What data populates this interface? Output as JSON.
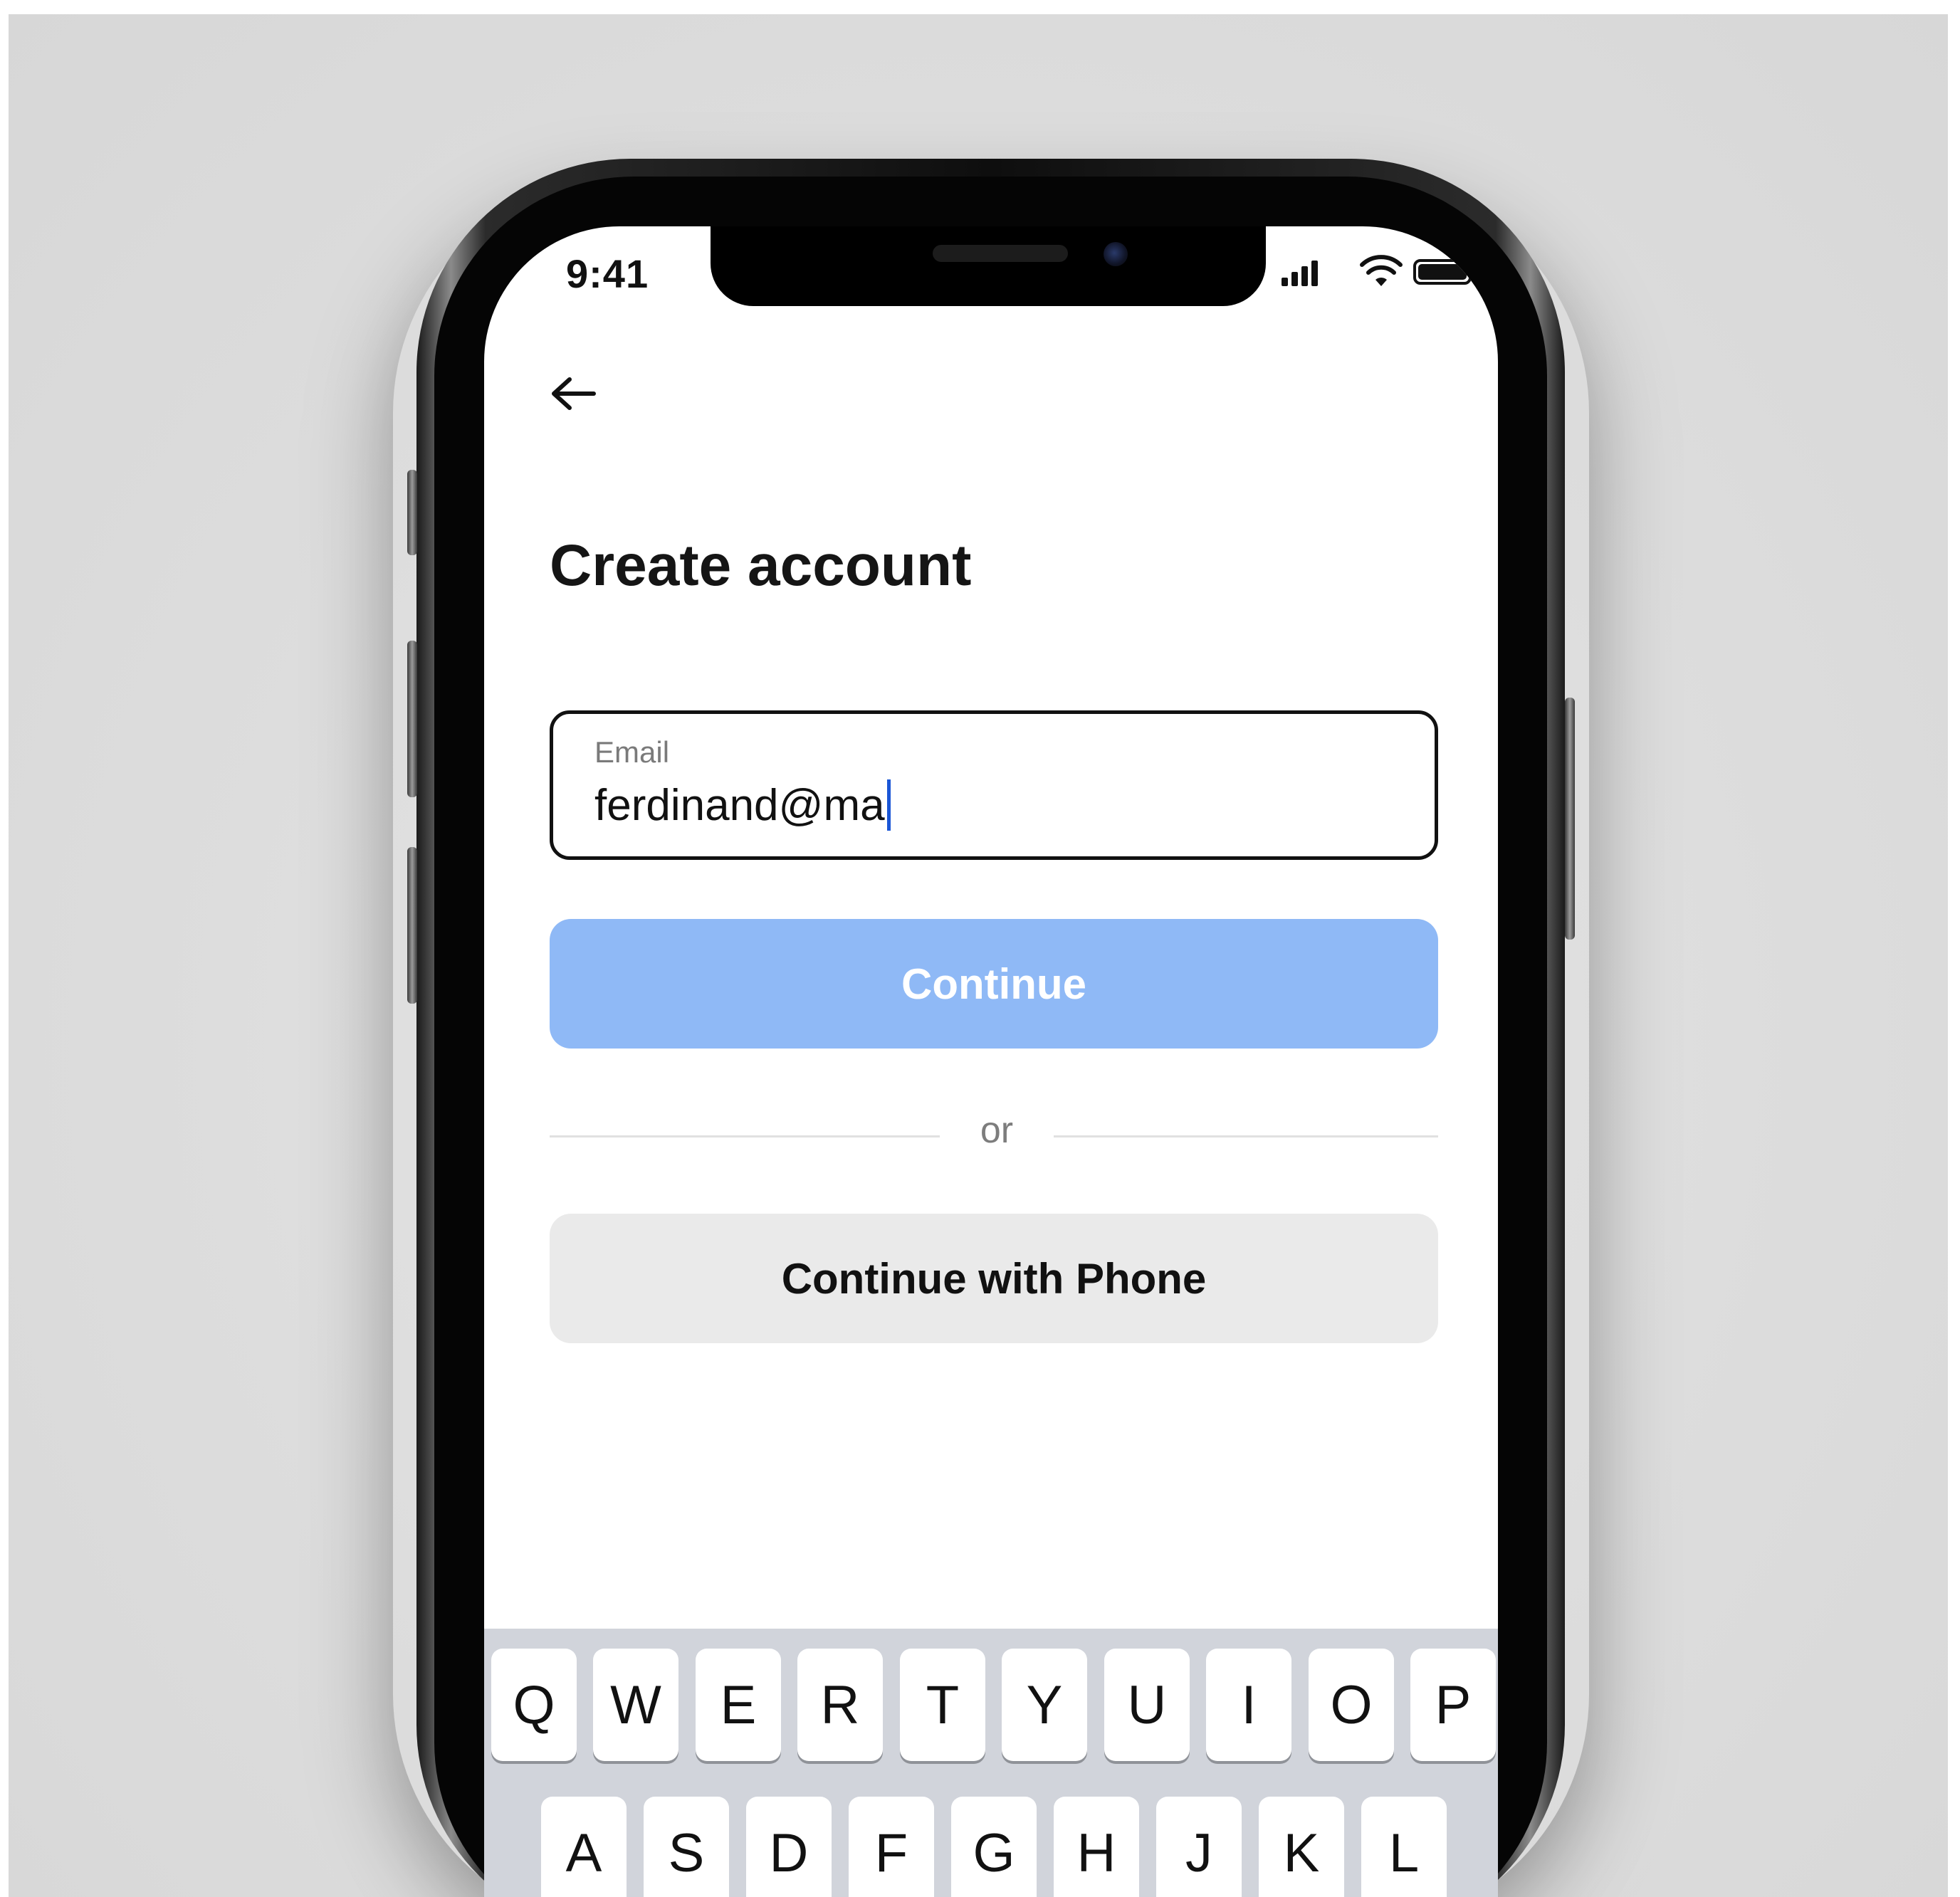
{
  "status_bar": {
    "time": "9:41",
    "icons": [
      "cellular-signal-icon",
      "wifi-icon",
      "battery-icon"
    ]
  },
  "navigation": {
    "back_icon": "arrow-left-icon"
  },
  "header": {
    "title": "Create account"
  },
  "form": {
    "email": {
      "label": "Email",
      "value": "ferdinand@ma"
    },
    "continue_label": "Continue",
    "divider_text": "or",
    "phone_label": "Continue with Phone"
  },
  "colors": {
    "primary_disabled": "#8fb9f6",
    "secondary_button": "#eaeaea",
    "caret": "#1a56d6",
    "keyboard_bg": "#d1d4db"
  },
  "keyboard": {
    "row1": [
      "Q",
      "W",
      "E",
      "R",
      "T",
      "Y",
      "U",
      "I",
      "O",
      "P"
    ],
    "row2": [
      "A",
      "S",
      "D",
      "F",
      "G",
      "H",
      "J",
      "K",
      "L"
    ]
  }
}
